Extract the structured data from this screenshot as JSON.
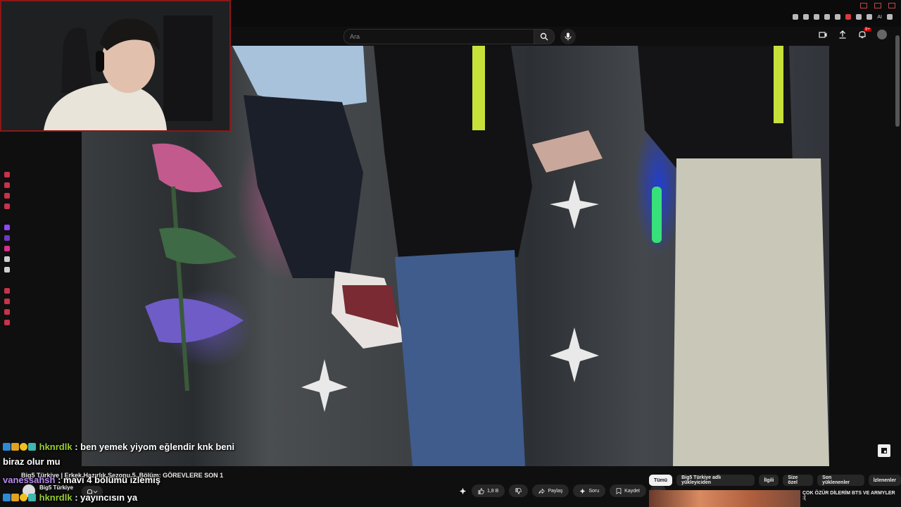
{
  "browser": {
    "ext_label": "AI"
  },
  "header": {
    "search_placeholder": "Ara",
    "notification_count": "9+"
  },
  "chat": [
    {
      "user": "hknrdlk",
      "message": ": ben yemek yiyom eğlendir knk beni",
      "user_color": "#9acd32"
    },
    {
      "user": "",
      "message": "biraz olur mu",
      "user_color": "#ffffff"
    },
    {
      "user": "vanessahsh",
      "message": ": mavi 4 bölümü izlemiş",
      "user_color": "#b98cf0"
    },
    {
      "user": "hknrdlk",
      "message": ": yayıncısın ya",
      "user_color": "#9acd32"
    }
  ],
  "video": {
    "title": "Big5 Türkiye | Erkek Hazırlık Sezonu 5. Bölüm: GÖREVLERE SON 1",
    "channel_name": "Big5 Türkiye",
    "like_count": "1,8 B",
    "share_label": "Paylaş",
    "ask_label": "Soru",
    "save_label": "Kaydet"
  },
  "chips": [
    "Tümü",
    "Big5 Türkiye adlı yükleyiciden",
    "İlgili",
    "Size özel",
    "Son yüklenenler",
    "İzlenenler"
  ],
  "recommendation": {
    "title": "ÇOK ÖZÜR DİLERİM BTS VE ARMYLER :("
  },
  "colors": {
    "cam_border": "#8a1717",
    "accent_red": "#cc0000"
  }
}
